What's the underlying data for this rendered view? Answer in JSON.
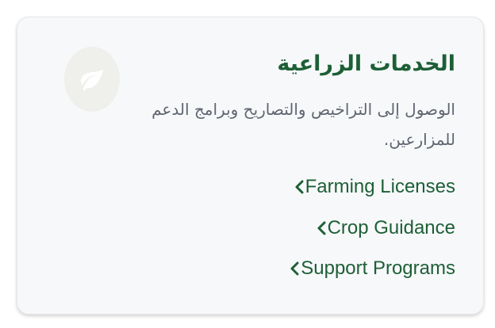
{
  "card": {
    "icon": "leaf-icon",
    "title": "الخدمات الزراعية",
    "description": "الوصول إلى التراخيص والتصاريح وبرامج الدعم للمزارعين.",
    "links": [
      {
        "label": "Farming Licenses",
        "icon": "chevron-left-icon"
      },
      {
        "label": "Crop Guidance",
        "icon": "chevron-left-icon"
      },
      {
        "label": "Support Programs",
        "icon": "chevron-left-icon"
      }
    ]
  },
  "colors": {
    "accent": "#1d5f36",
    "text_muted": "#5f6570",
    "card_bg": "#f7f8fa",
    "icon_bg": "#efefeb",
    "icon_fg": "#ffffff"
  }
}
